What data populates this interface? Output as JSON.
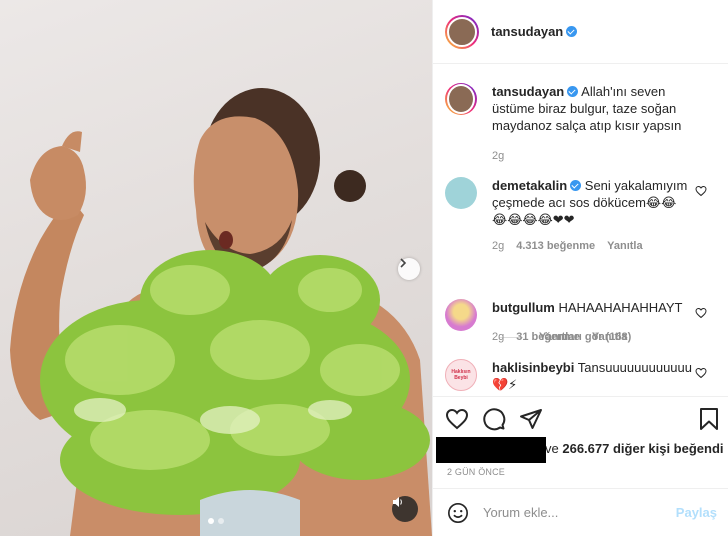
{
  "post": {
    "username": "tansudayan",
    "verified": true
  },
  "caption": {
    "username": "tansudayan",
    "text": "Allah'ını seven üstüme biraz bulgur, taze soğan maydanoz salça atıp kısır yapsın",
    "time": "2g"
  },
  "comments": [
    {
      "username": "demetakalin",
      "verified": true,
      "text": "Seni yakalamıyım çeşmede acı sos dökücem😂😂 😂😂😂😂❤❤",
      "time": "2g",
      "likes": "4.313 beğenme",
      "reply_label": "Yanıtla",
      "view_replies": "Yanıtları gör (168)"
    },
    {
      "username": "butgullum",
      "verified": false,
      "text": "HAHAAHAHAHHAYT",
      "time": "2g",
      "likes": "31 beğenme",
      "reply_label": "Yanıtla"
    },
    {
      "username": "haklisinbeybi",
      "verified": false,
      "text": "Tansuuuuuuuuuuuu 💔⚡",
      "avatar_text": "Haklısın Beybi"
    }
  ],
  "likes": {
    "prefix": "ve",
    "count": "266.677",
    "suffix": "diğer kişi beğendi"
  },
  "time_ago": "2 GÜN ÖNCE",
  "add_comment": {
    "placeholder": "Yorum ekle...",
    "post_label": "Paylaş"
  },
  "carousel": {
    "count": 2,
    "active": 1
  },
  "colors": {
    "verified": "#3897f0",
    "post_button": "#b2dffc",
    "muted": "#8e8e8e"
  },
  "icons": [
    "heart-icon",
    "comment-icon",
    "share-icon",
    "bookmark-icon",
    "smiley-icon",
    "chevron-right-icon",
    "speaker-icon"
  ]
}
